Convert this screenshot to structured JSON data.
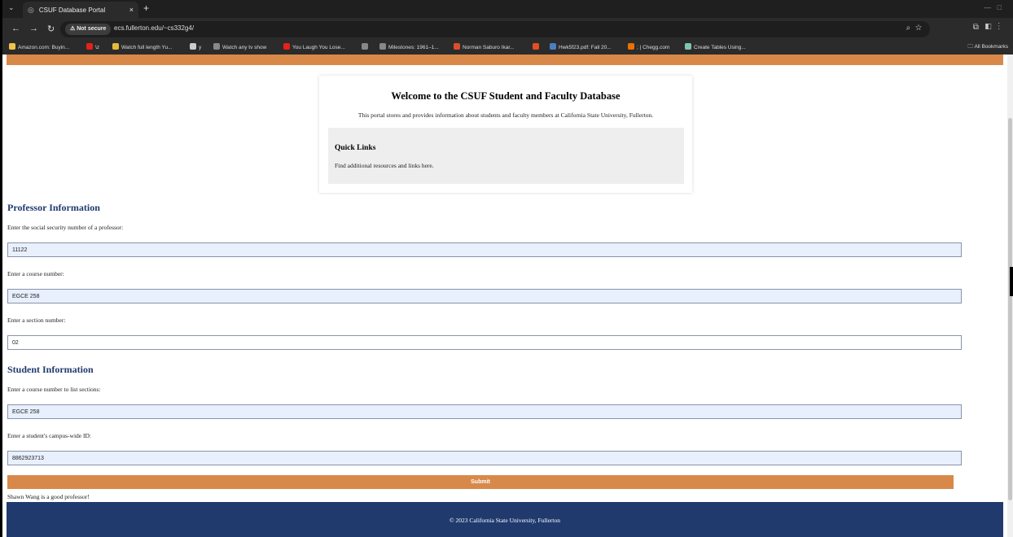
{
  "browser": {
    "tab_title": "CSUF Database Portal",
    "tab_close": "×",
    "new_tab": "+",
    "not_secure": "⚠ Not secure",
    "url": "ecs.fullerton.edu/~cs332g4/",
    "bookmarks": [
      {
        "label": "Amazon.com: Buyin...",
        "color": "#f0c14b"
      },
      {
        "label": "\\z",
        "color": "#e62117"
      },
      {
        "label": "Watch full length Yu...",
        "color": "#e5b93a"
      },
      {
        "label": "y",
        "color": "#cccccc"
      },
      {
        "label": "Watch any tv show",
        "color": "#888888"
      },
      {
        "label": "You Laugh You Lose...",
        "color": "#e62117"
      },
      {
        "label": "",
        "color": "#888888"
      },
      {
        "label": "Milestones: 1961–1...",
        "color": "#888888"
      },
      {
        "label": "Norman Saburo Ikar...",
        "color": "#d94f2b"
      },
      {
        "label": "",
        "color": "#e44d26"
      },
      {
        "label": "Hwk5f23.pdf: Fall 20...",
        "color": "#4a7fc1"
      },
      {
        "label": "; | Chegg.com",
        "color": "#eb7100"
      },
      {
        "label": "Create Tables Using...",
        "color": "#7ec8a8"
      }
    ],
    "all_bookmarks": "All Bookmarks"
  },
  "colors": {
    "accent_orange": "#d8894a",
    "brand_navy": "#203a6e"
  },
  "welcome": {
    "title": "Welcome to the CSUF Student and Faculty Database",
    "description": "This portal stores and provides information about students and faculty members at California State University, Fullerton.",
    "quick_links_title": "Quick Links",
    "quick_links_text": "Find additional resources and links here."
  },
  "professor": {
    "heading": "Professor Information",
    "ssn_label": "Enter the social security number of a professor:",
    "ssn_value": "11122",
    "course_label": "Enter a course number:",
    "course_value": "EGCE 258",
    "section_label": "Enter a section number:",
    "section_value": "02"
  },
  "student": {
    "heading": "Student Information",
    "course_label": "Enter a course number to list sections:",
    "course_value": "EGCE 258",
    "cwid_label": "Enter a student's campus-wide ID:",
    "cwid_value": "8862923713"
  },
  "submit_label": "Submit",
  "result_text": "Shawn Wang is a good professor!",
  "footer_text": "© 2023 California State University, Fullerton"
}
